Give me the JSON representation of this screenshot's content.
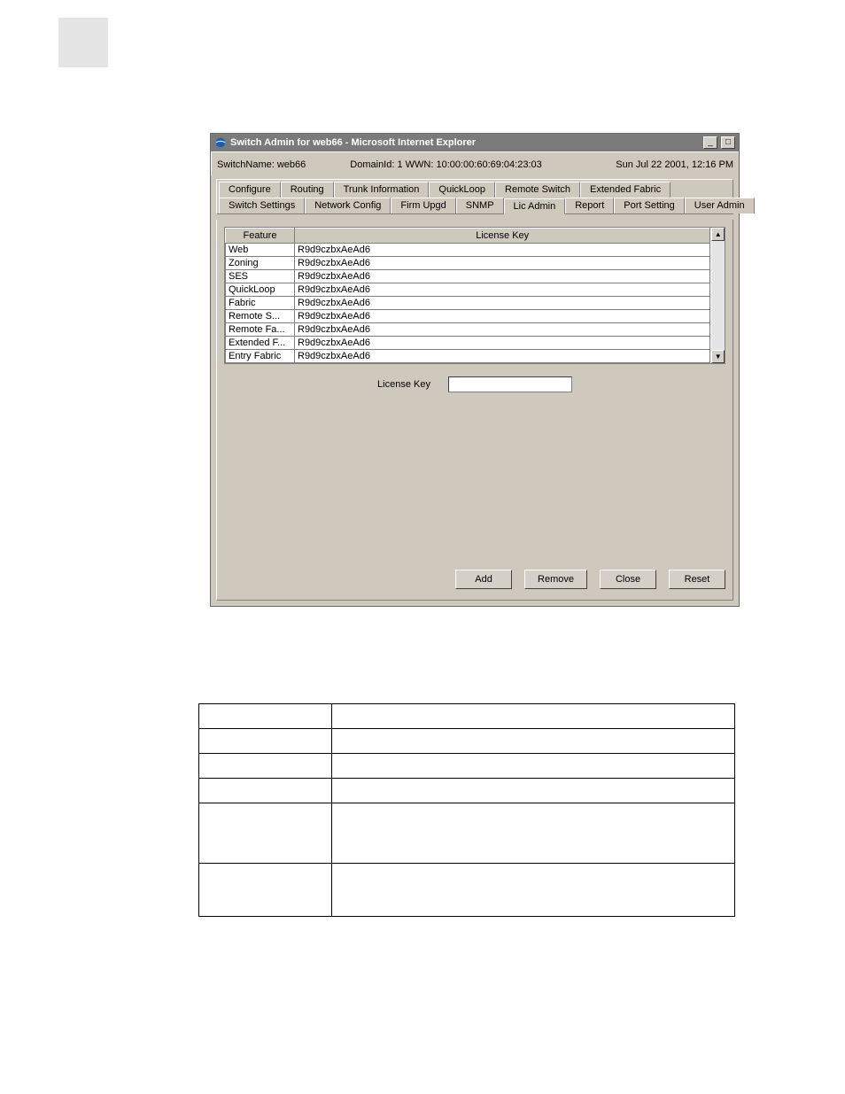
{
  "window": {
    "title": "Switch Admin for web66 - Microsoft Internet Explorer",
    "status": {
      "switchname_label": "SwitchName:",
      "switchname": "web66",
      "domain_wwn_label": "DomainId:",
      "domain_wwn": "1 WWN: 10:00:00:60:69:04:23:03",
      "datetime": "Sun Jul 22  2001, 12:16 PM"
    },
    "tabs_row1": [
      "Configure",
      "Routing",
      "Trunk Information",
      "QuickLoop",
      "Remote Switch",
      "Extended Fabric"
    ],
    "tabs_row2": [
      "Switch Settings",
      "Network Config",
      "Firm Upgd",
      "SNMP",
      "Lic Admin",
      "Report",
      "Port Setting",
      "User Admin"
    ],
    "active_tab": "Lic Admin",
    "table": {
      "col1": "Feature",
      "col2": "License Key",
      "rows": [
        {
          "feature": "Web",
          "key": "R9d9czbxAeAd6"
        },
        {
          "feature": "Zoning",
          "key": "R9d9czbxAeAd6"
        },
        {
          "feature": "SES",
          "key": "R9d9czbxAeAd6"
        },
        {
          "feature": "QuickLoop",
          "key": "R9d9czbxAeAd6"
        },
        {
          "feature": "Fabric",
          "key": "R9d9czbxAeAd6"
        },
        {
          "feature": "Remote S...",
          "key": "R9d9czbxAeAd6"
        },
        {
          "feature": "Remote Fa...",
          "key": "R9d9czbxAeAd6"
        },
        {
          "feature": "Extended F...",
          "key": "R9d9czbxAeAd6"
        },
        {
          "feature": "Entry Fabric",
          "key": "R9d9czbxAeAd6"
        }
      ]
    },
    "lickey_label": "License Key",
    "lickey_value": "",
    "buttons": {
      "add": "Add",
      "remove": "Remove",
      "close": "Close",
      "reset": "Reset"
    }
  },
  "desc_rows": [
    {
      "c1": "",
      "c2": ""
    },
    {
      "c1": "",
      "c2": ""
    },
    {
      "c1": "",
      "c2": ""
    },
    {
      "c1": "",
      "c2": ""
    },
    {
      "c1": "",
      "c2": ""
    },
    {
      "c1": "",
      "c2": ""
    }
  ]
}
